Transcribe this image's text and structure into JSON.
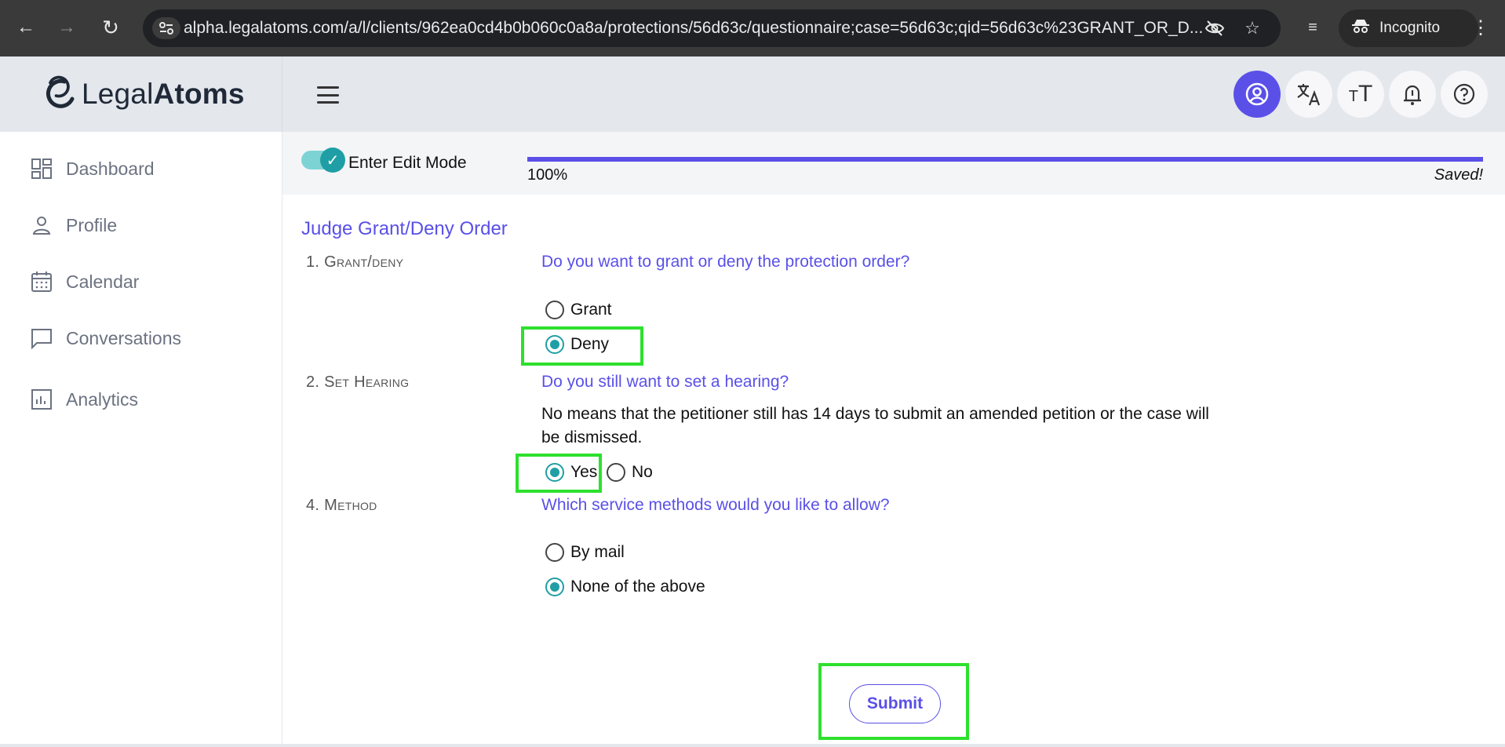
{
  "browser": {
    "url": "alpha.legalatoms.com/a/l/clients/962ea0cd4b0b060c0a8a/protections/56d63c/questionnaire;case=56d63c;qid=56d63c%23GRANT_OR_D...",
    "incognito_label": "Incognito"
  },
  "brand": {
    "name_light": "Legal",
    "name_bold": "Atoms"
  },
  "sidebar": {
    "items": [
      {
        "label": "Dashboard",
        "icon": "dashboard-icon"
      },
      {
        "label": "Profile",
        "icon": "user-icon"
      },
      {
        "label": "Calendar",
        "icon": "calendar-icon"
      },
      {
        "label": "Conversations",
        "icon": "chat-icon"
      },
      {
        "label": "Analytics",
        "icon": "analytics-icon"
      }
    ]
  },
  "edit_mode": {
    "label": "Enter Edit Mode",
    "enabled": true
  },
  "progress": {
    "percent_label": "100%",
    "value": 1.0,
    "status": "Saved!"
  },
  "colors": {
    "accent": "#5a50e8",
    "teal": "#1f9fa5",
    "highlight": "#2ee02e"
  },
  "form": {
    "title": "Judge Grant/Deny Order",
    "questions": [
      {
        "number": "1. Grant/deny",
        "text": "Do you want to grant or deny the protection order?",
        "options": [
          {
            "label": "Grant",
            "selected": false
          },
          {
            "label": "Deny",
            "selected": true
          }
        ]
      },
      {
        "number": "2. Set Hearing",
        "text": "Do you still want to set a hearing?",
        "help": "No means that the petitioner still has 14 days to submit an amended petition or the case will be dismissed.",
        "options": [
          {
            "label": "Yes",
            "selected": true
          },
          {
            "label": "No",
            "selected": false
          }
        ]
      },
      {
        "number": "4. Method",
        "text": "Which service methods would you like to allow?",
        "options": [
          {
            "label": "By mail",
            "selected": false
          },
          {
            "label": "None of the above",
            "selected": true
          }
        ]
      }
    ],
    "submit_label": "Submit"
  }
}
